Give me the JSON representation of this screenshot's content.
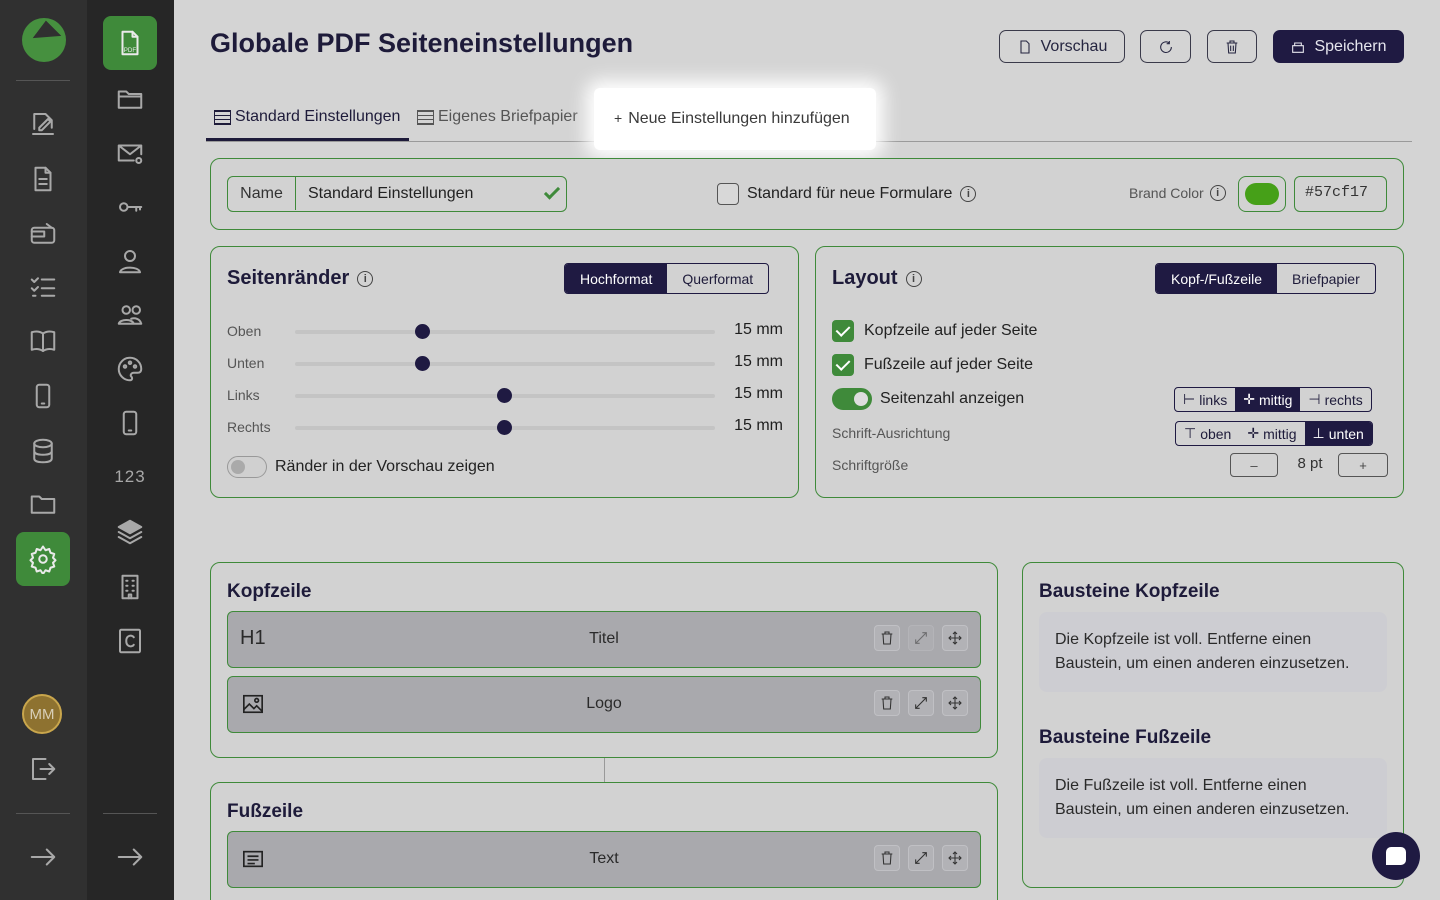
{
  "sidebar_primary": {
    "items": [
      "logo-icon",
      "edit-document-icon",
      "document-icon",
      "wallet-icon",
      "checklist-icon",
      "book-icon",
      "mobile-icon",
      "database-icon",
      "folder-icon",
      "settings-icon"
    ],
    "active": "settings-icon",
    "avatar_initials": "MM"
  },
  "sidebar_secondary": {
    "items": [
      "pdf-file-icon",
      "folder-icon",
      "mail-at-icon",
      "key-icon",
      "user-icon",
      "users-icon",
      "palette-icon",
      "mobile-icon",
      "numbers-text",
      "layers-icon",
      "building-icon",
      "c-box-icon"
    ],
    "numbers_label": "123",
    "active": "pdf-file-icon"
  },
  "header": {
    "title": "Globale PDF Seiteneinstellungen",
    "buttons": {
      "preview": "Vorschau",
      "save": "Speichern"
    }
  },
  "tabs": {
    "items": [
      {
        "label": "Standard Einstellungen"
      },
      {
        "label": "Eigenes Briefpapier"
      }
    ],
    "add_label": "Neue Einstellungen hinzufügen",
    "add_symbol": "+"
  },
  "settings_bar": {
    "name_label": "Name",
    "name_value": "Standard Einstellungen",
    "default_label": "Standard für neue Formulare",
    "default_checked": false,
    "brand_color_label": "Brand Color",
    "brand_color_value": "#57cf17",
    "brand_color_swatch": "#46a018"
  },
  "margins": {
    "title": "Seitenränder",
    "orientation_options": [
      "Hochformat",
      "Querformat"
    ],
    "orientation_selected": "Hochformat",
    "rows": [
      {
        "label": "Oben",
        "value": "15 mm",
        "fraction": 0.31
      },
      {
        "label": "Unten",
        "value": "15 mm",
        "fraction": 0.31
      },
      {
        "label": "Links",
        "value": "15 mm",
        "fraction": 0.5
      },
      {
        "label": "Rechts",
        "value": "15 mm",
        "fraction": 0.5
      }
    ],
    "show_preview_label": "Ränder in der Vorschau zeigen",
    "show_preview_on": false
  },
  "layout": {
    "title": "Layout",
    "mode_options": [
      "Kopf-/Fußzeile",
      "Briefpapier"
    ],
    "mode_selected": "Kopf-/Fußzeile",
    "header_each_page": "Kopfzeile auf jeder Seite",
    "footer_each_page": "Fußzeile auf jeder Seite",
    "page_number_label": "Seitenzahl anzeigen",
    "page_number_on": true,
    "align_h_options": [
      "links",
      "mittig",
      "rechts"
    ],
    "align_h_selected": "mittig",
    "font_align_label": "Schrift-Ausrichtung",
    "align_v_options": [
      "oben",
      "mittig",
      "unten"
    ],
    "align_v_selected": "unten",
    "font_size_label": "Schriftgröße",
    "font_size_value": "8 pt",
    "minus": "–",
    "plus": "+"
  },
  "kopfzeile": {
    "title": "Kopfzeile",
    "blocks": [
      {
        "icon_text": "H1",
        "name": "Titel"
      },
      {
        "icon_text": "",
        "name": "Logo"
      }
    ]
  },
  "fusszeile": {
    "title": "Fußzeile",
    "blocks": [
      {
        "name": "Text"
      }
    ]
  },
  "bausteine": {
    "header_title": "Bausteine Kopfzeile",
    "header_note": "Die Kopfzeile ist voll. Entferne einen Baustein, um einen anderen einzusetzen.",
    "footer_title": "Bausteine Fußzeile",
    "footer_note": "Die Fußzeile ist voll. Entferne einen Baustein, um einen anderen einzusetzen."
  },
  "colors": {
    "accent": "#3f8a3a",
    "navy": "#1f1a42",
    "rail": "#303030"
  }
}
